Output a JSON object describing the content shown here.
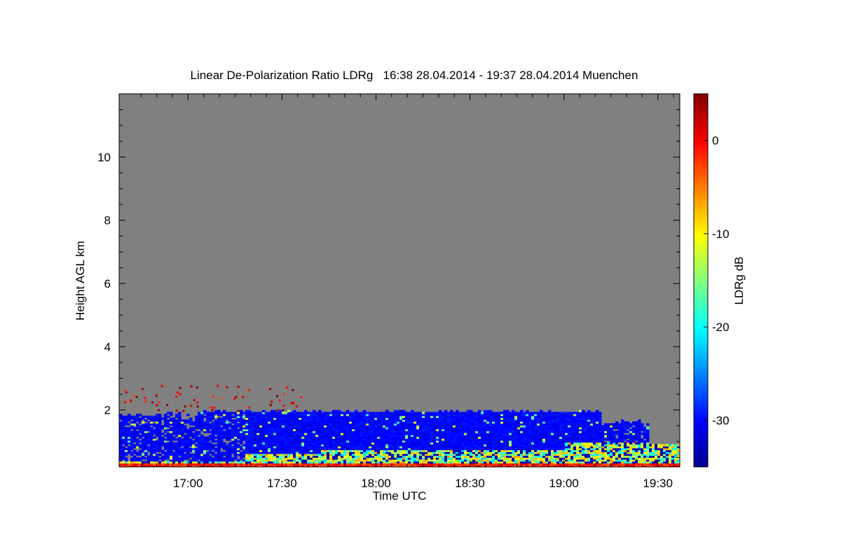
{
  "chart_data": {
    "type": "heatmap",
    "title": "Linear De-Polarization Ratio LDRg   16:38 28.04.2014 - 19:37 28.04.2014 Muenchen",
    "xlabel": "Time UTC",
    "ylabel": "Height AGL km",
    "x_ticks": [
      {
        "label": "17:00",
        "value": 17.0
      },
      {
        "label": "17:30",
        "value": 17.5
      },
      {
        "label": "18:00",
        "value": 18.0
      },
      {
        "label": "18:30",
        "value": 18.5
      },
      {
        "label": "19:00",
        "value": 19.0
      },
      {
        "label": "19:30",
        "value": 19.5
      }
    ],
    "xlim": [
      16.6333,
      19.6167
    ],
    "y_ticks": [
      {
        "label": "2",
        "value": 2
      },
      {
        "label": "4",
        "value": 4
      },
      {
        "label": "6",
        "value": 6
      },
      {
        "label": "8",
        "value": 8
      },
      {
        "label": "10",
        "value": 10
      }
    ],
    "ylim": [
      0.2,
      12.0
    ],
    "colorbar": {
      "label": "LDRg dB",
      "range": [
        -35,
        5
      ],
      "ticks": [
        {
          "label": "0",
          "value": 0
        },
        {
          "label": "-10",
          "value": -10
        },
        {
          "label": "-20",
          "value": -20
        },
        {
          "label": "-30",
          "value": -30
        }
      ],
      "colormap": "jet"
    },
    "background_color": "#808080",
    "features": [
      {
        "feature": "aerosol boundary layer",
        "time_start": 16.63,
        "time_end": 19.45,
        "height_bottom": 0.4,
        "height_top": 1.95,
        "ldr_db": -31
      },
      {
        "feature": "near-surface layer",
        "time_start": 16.63,
        "time_end": 19.62,
        "height_bottom": 0.2,
        "height_top": 0.6,
        "ldr_db": -15
      },
      {
        "feature": "scattered returns",
        "time_start": 16.63,
        "time_end": 17.6,
        "height_bottom": 2.0,
        "height_top": 2.8,
        "ldr_db": 0
      }
    ]
  }
}
